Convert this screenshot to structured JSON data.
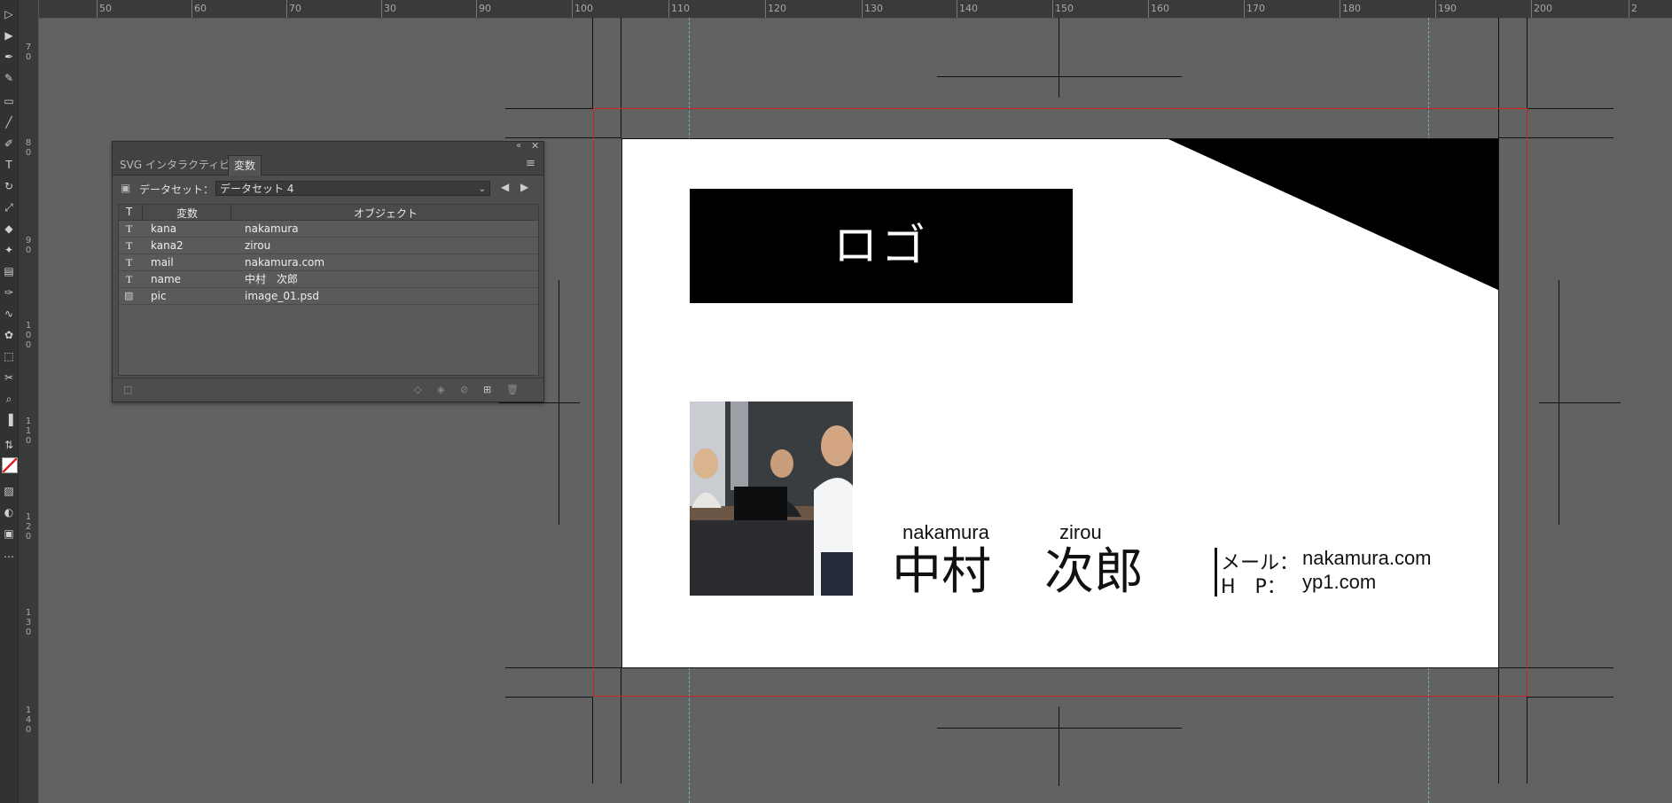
{
  "ruler": {
    "h_labels": [
      "50",
      "60",
      "70",
      "30",
      "90",
      "100",
      "110",
      "120",
      "130",
      "140",
      "150",
      "160",
      "170",
      "180",
      "190",
      "200",
      "2"
    ],
    "v_labels": [
      "7\n0",
      "8\n0",
      "9\n0",
      "1\n0\n0",
      "1\n1\n0",
      "1\n2\n0",
      "1\n3\n0",
      "1\n4\n0"
    ]
  },
  "panel": {
    "tabs": [
      {
        "label": "SVG インタラクティビティ",
        "active": false
      },
      {
        "label": "変数",
        "active": true
      }
    ],
    "dataset_label": "データセット：",
    "dataset_value": "データセット 4",
    "columns": [
      "T",
      "変数",
      "オブジェクト"
    ],
    "rows": [
      {
        "type": "T",
        "var": "kana",
        "obj": "nakamura"
      },
      {
        "type": "T",
        "var": "kana2",
        "obj": "zirou"
      },
      {
        "type": "T",
        "var": "mail",
        "obj": "nakamura.com"
      },
      {
        "type": "T",
        "var": "name",
        "obj": "中村　次郎"
      },
      {
        "type": "image",
        "var": "pic",
        "obj": "image_01.psd"
      }
    ]
  },
  "card": {
    "logo": "ロゴ",
    "kana_family": "nakamura",
    "kana_given": "zirou",
    "name_family": "中村",
    "name_given": "次郎",
    "mail_label": "メール：",
    "mail_value": "nakamura.com",
    "hp_label": "H　P：",
    "hp_value": "yp1.com"
  },
  "colors": {
    "bleed_line": "#cc2222",
    "guide": "#6fb5b5",
    "canvas": "#626262"
  }
}
